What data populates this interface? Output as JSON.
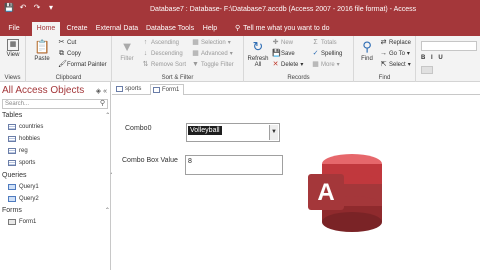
{
  "titlebar": {
    "title": "Database7 : Database- F:\\Database7.accdb (Access 2007 - 2016 file format) - Access",
    "qat_icons": [
      "save-icon",
      "undo-icon",
      "redo-icon",
      "customize-icon"
    ]
  },
  "tabs": [
    {
      "label": "File"
    },
    {
      "label": "Home"
    },
    {
      "label": "Create"
    },
    {
      "label": "External Data"
    },
    {
      "label": "Database Tools"
    },
    {
      "label": "Help"
    }
  ],
  "tell_me": "Tell me what you want to do",
  "ribbon": {
    "views": {
      "view_label": "View",
      "group_label": "Views"
    },
    "clipboard": {
      "paste_label": "Paste",
      "cut_label": "Cut",
      "copy_label": "Copy",
      "format_painter_label": "Format Painter",
      "group_label": "Clipboard"
    },
    "sort_filter": {
      "filter_label": "Filter",
      "ascending_label": "Ascending",
      "descending_label": "Descending",
      "remove_sort_label": "Remove Sort",
      "selection_label": "Selection",
      "advanced_label": "Advanced",
      "toggle_filter_label": "Toggle Filter",
      "group_label": "Sort & Filter"
    },
    "records": {
      "refresh_label": "Refresh",
      "refresh_label2": "All",
      "new_label": "New",
      "save_label": "Save",
      "delete_label": "Delete",
      "totals_label": "Totals",
      "spelling_label": "Spelling",
      "more_label": "More",
      "group_label": "Records"
    },
    "find": {
      "find_label": "Find",
      "replace_label": "Replace",
      "goto_label": "Go To",
      "select_label": "Select",
      "group_label": "Find"
    }
  },
  "nav": {
    "header": "All Access Objects",
    "search_placeholder": "Search...",
    "sections": [
      {
        "label": "Tables",
        "items": [
          "countries",
          "hobbies",
          "reg",
          "sports"
        ]
      },
      {
        "label": "Queries",
        "items": [
          "Query1",
          "Query2"
        ]
      },
      {
        "label": "Forms",
        "items": [
          "Form1"
        ]
      }
    ]
  },
  "doc_tabs": [
    {
      "label": "sports"
    },
    {
      "label": "Form1"
    }
  ],
  "form": {
    "combo_label": "Combo0",
    "combo_value": "Volleyball",
    "combo_box_value_label": "Combo Box Value",
    "combo_box_value": "8"
  },
  "colors": {
    "accent": "#a4373a",
    "ribbon_bg": "#f3f3f3"
  }
}
